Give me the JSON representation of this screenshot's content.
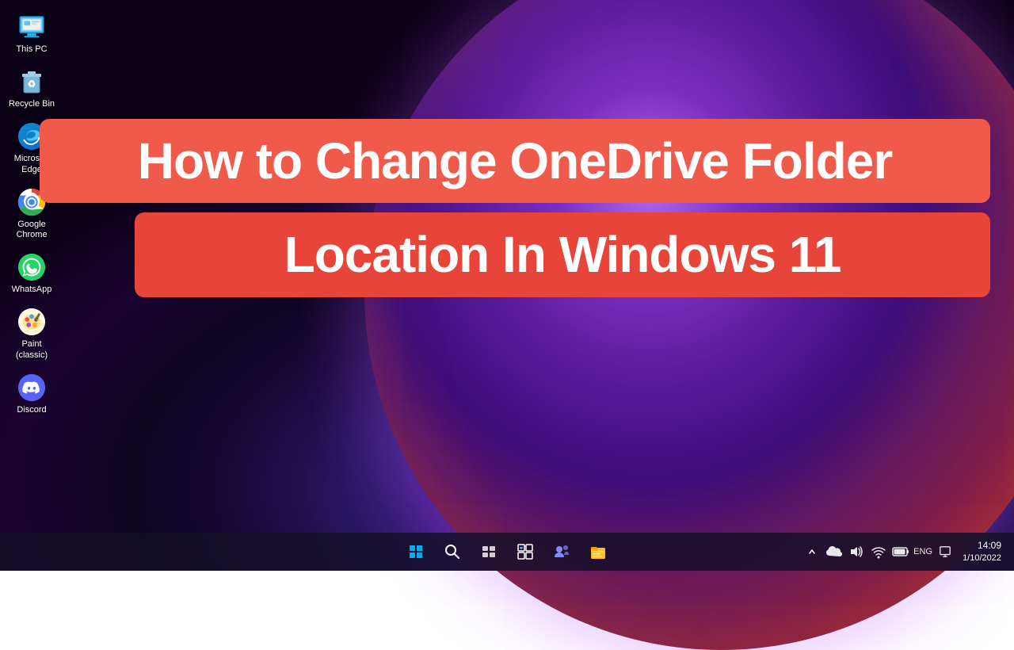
{
  "desktop": {
    "icons": [
      {
        "id": "this-pc",
        "label": "This PC",
        "type": "this-pc"
      },
      {
        "id": "recycle-bin",
        "label": "Recycle Bin",
        "type": "recycle-bin"
      },
      {
        "id": "microsoft-edge",
        "label": "Microsoft Edge",
        "type": "edge"
      },
      {
        "id": "google-chrome",
        "label": "Google Chrome",
        "type": "chrome"
      },
      {
        "id": "whatsapp",
        "label": "WhatsApp",
        "type": "whatsapp"
      },
      {
        "id": "paint-classic",
        "label": "Paint (classic)",
        "type": "paint"
      },
      {
        "id": "discord",
        "label": "Discord",
        "type": "discord"
      }
    ]
  },
  "banners": {
    "line1": "How to Change OneDrive Folder",
    "line2": "Location In Windows 11"
  },
  "taskbar": {
    "start_label": "Start",
    "search_label": "Search",
    "task_view_label": "Task View",
    "widgets_label": "Widgets",
    "teams_label": "Teams",
    "file_explorer_label": "File Explorer"
  },
  "clock": {
    "time": "14:09",
    "date": "1/10/2022"
  },
  "tray": {
    "chevron": "^",
    "icons": [
      "battery",
      "network",
      "volume",
      "keyboard",
      "display"
    ]
  }
}
